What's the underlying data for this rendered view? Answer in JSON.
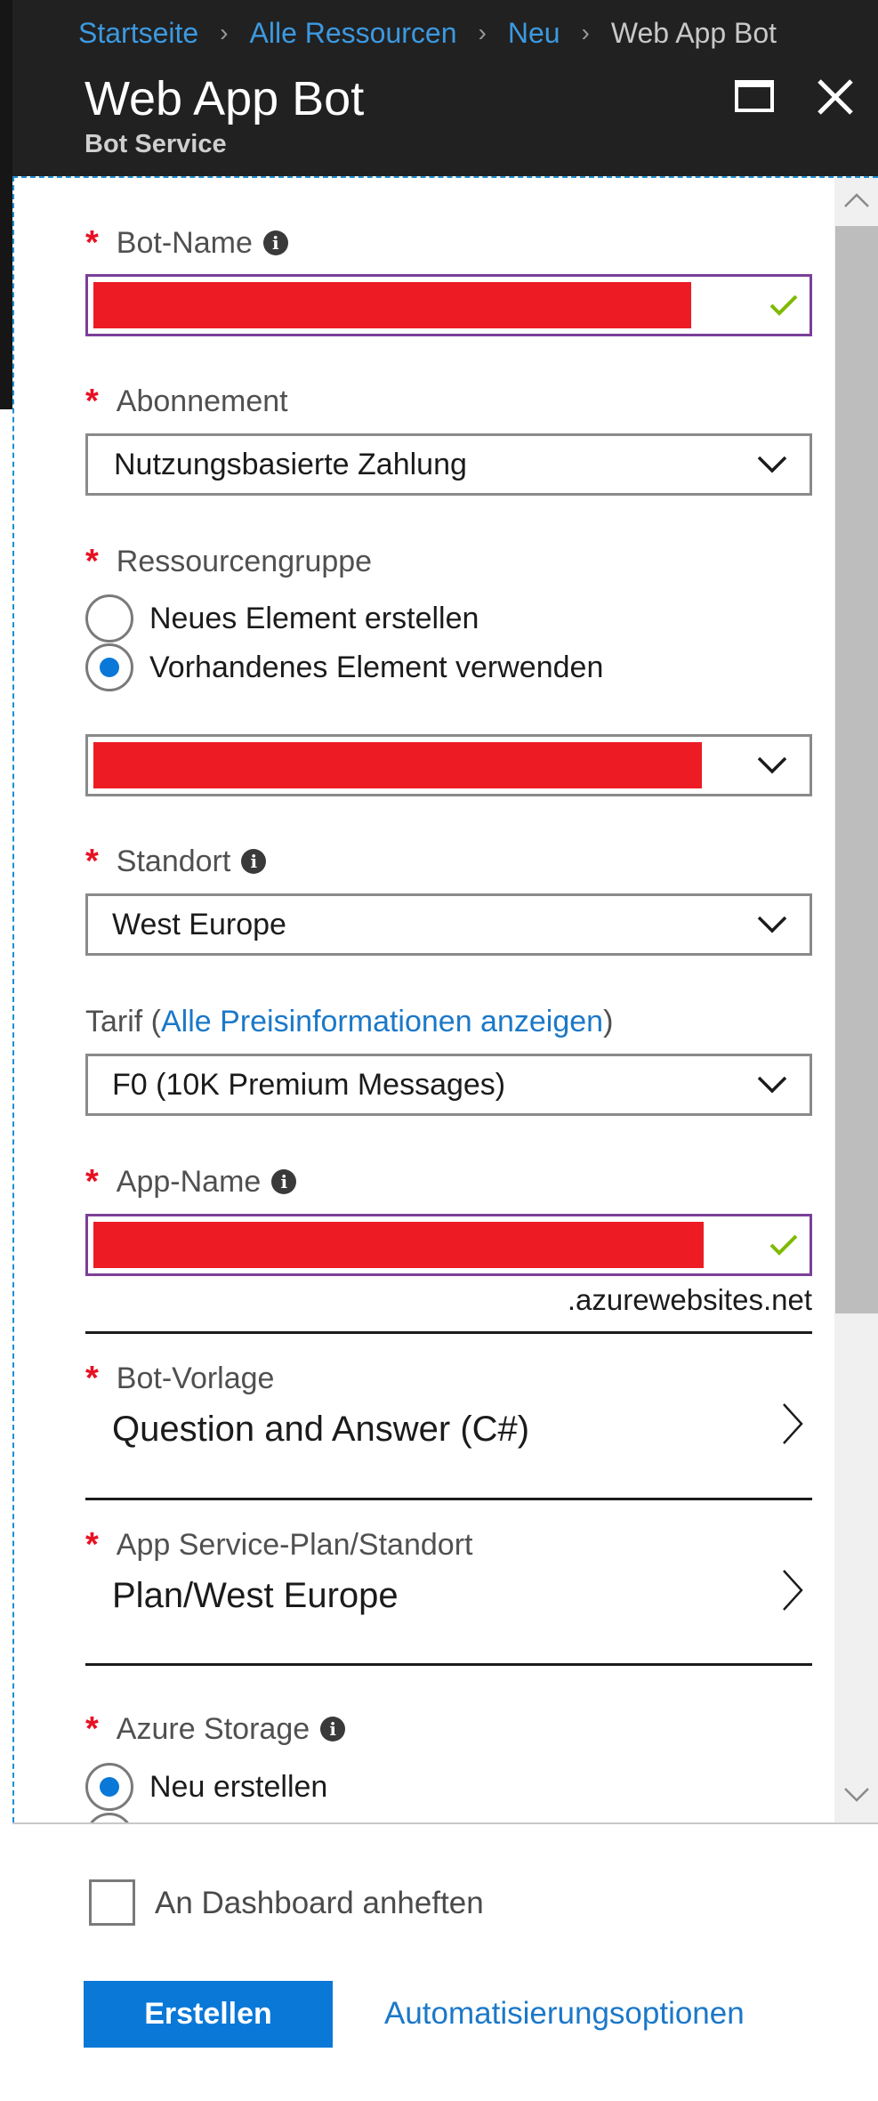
{
  "breadcrumb": {
    "items": [
      "Startseite",
      "Alle Ressourcen",
      "Neu"
    ],
    "current": "Web App Bot"
  },
  "blade": {
    "title": "Web App Bot",
    "subtitle": "Bot Service"
  },
  "form": {
    "bot_name": {
      "label": "Bot-Name",
      "value_redacted": true
    },
    "subscription": {
      "label": "Abonnement",
      "value": "Nutzungsbasierte Zahlung"
    },
    "resource_group": {
      "label": "Ressourcengruppe",
      "options": [
        {
          "label": "Neues Element erstellen",
          "selected": false
        },
        {
          "label": "Vorhandenes Element verwenden",
          "selected": true
        }
      ],
      "value_redacted": true
    },
    "location": {
      "label": "Standort",
      "value": "West Europe"
    },
    "pricing": {
      "label_prefix": "Tarif (",
      "link": "Alle Preisinformationen anzeigen",
      "label_suffix": ")",
      "value": "F0 (10K Premium Messages)"
    },
    "app_name": {
      "label": "App-Name",
      "value_redacted": true,
      "suffix": ".azurewebsites.net"
    },
    "bot_template": {
      "label": "Bot-Vorlage",
      "value": "Question and Answer (C#)"
    },
    "app_service_plan": {
      "label": "App Service-Plan/Standort",
      "value": "Plan/West Europe"
    },
    "azure_storage": {
      "label": "Azure Storage",
      "options": [
        {
          "label": "Neu erstellen",
          "selected": true
        }
      ]
    }
  },
  "footer": {
    "pin_label": "An Dashboard anheften",
    "pin_checked": false,
    "create_button": "Erstellen",
    "automation_link": "Automatisierungsoptionen"
  },
  "colors": {
    "accent": "#0a78d7",
    "required": "#e81123",
    "valid": "#7fba00",
    "redaction": "#ed1c24",
    "focus_border": "#7b3f99",
    "header_bg": "#212121"
  }
}
